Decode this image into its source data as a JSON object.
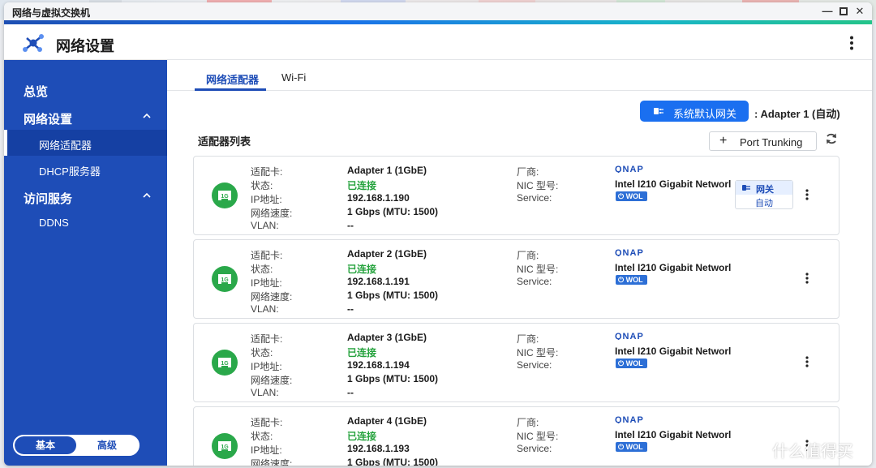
{
  "window": {
    "title": "网络与虚拟交换机"
  },
  "header": {
    "title": "网络设置"
  },
  "sidebar": {
    "sections": [
      {
        "label": "总览"
      },
      {
        "label": "网络设置",
        "items": [
          {
            "label": "网络适配器",
            "active": true
          },
          {
            "label": "DHCP服务器"
          }
        ]
      },
      {
        "label": "访问服务",
        "items": [
          {
            "label": "DDNS"
          }
        ]
      }
    ],
    "mode": {
      "basic": "基本",
      "advanced": "高级"
    }
  },
  "tabs": [
    {
      "label": "网络适配器",
      "active": true
    },
    {
      "label": "Wi-Fi"
    }
  ],
  "gateway": {
    "button_label": "系统默认网关",
    "value_text": ": Adapter 1 (自动)"
  },
  "adapter_list": {
    "title": "适配器列表",
    "port_trunking_label": "Port Trunking",
    "field_labels": {
      "card": "适配卡:",
      "status": "状态:",
      "ip": "IP地址:",
      "speed": "网络速度:",
      "vlan": "VLAN:",
      "vendor": "厂商:",
      "nic_model": "NIC 型号:",
      "service": "Service:"
    },
    "items": [
      {
        "name": "Adapter 1 (1GbE)",
        "status": "已连接",
        "ip": "192.168.1.190",
        "speed": "1 Gbps (MTU: 1500)",
        "vlan": "--",
        "vendor_logo": "QNAP",
        "nic_model": "Intel I210 Gigabit Networl",
        "service": "WOL",
        "badge": "1G",
        "gateway_tag": {
          "label": "网关",
          "mode": "自动"
        }
      },
      {
        "name": "Adapter 2 (1GbE)",
        "status": "已连接",
        "ip": "192.168.1.191",
        "speed": "1 Gbps (MTU: 1500)",
        "vlan": "--",
        "vendor_logo": "QNAP",
        "nic_model": "Intel I210 Gigabit Networl",
        "service": "WOL",
        "badge": "1G"
      },
      {
        "name": "Adapter 3 (1GbE)",
        "status": "已连接",
        "ip": "192.168.1.194",
        "speed": "1 Gbps (MTU: 1500)",
        "vlan": "--",
        "vendor_logo": "QNAP",
        "nic_model": "Intel I210 Gigabit Networl",
        "service": "WOL",
        "badge": "1G"
      },
      {
        "name": "Adapter 4 (1GbE)",
        "status": "已连接",
        "ip": "192.168.1.193",
        "speed": "1 Gbps (MTU: 1500)",
        "vlan": "--",
        "vendor_logo": "QNAP",
        "nic_model": "Intel I210 Gigabit Networl",
        "service": "WOL",
        "badge": "1G"
      }
    ]
  },
  "watermark": {
    "text": "什么值得买"
  },
  "colors": {
    "sidebar": "#1e4db7",
    "accent": "#1a6ff0",
    "connected": "#26a33e",
    "badge": "#2aa84a"
  }
}
